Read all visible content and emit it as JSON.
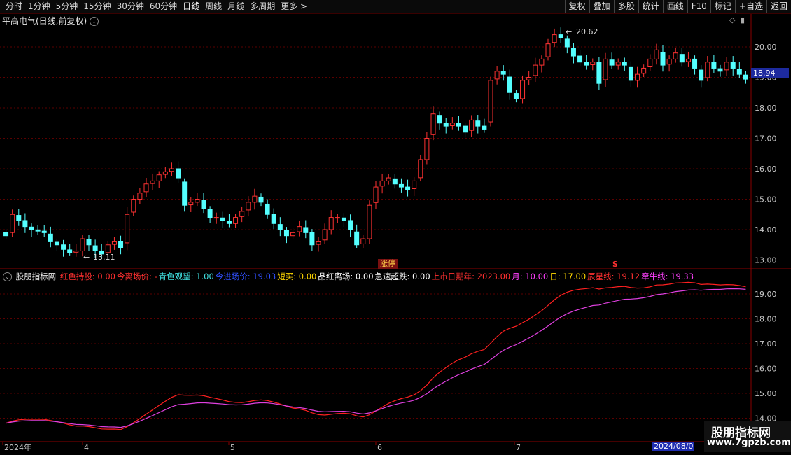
{
  "toolbar": {
    "periods": [
      "分时",
      "1分钟",
      "5分钟",
      "15分钟",
      "30分钟",
      "60分钟",
      "日线",
      "周线",
      "月线",
      "多周期",
      "更多 >"
    ],
    "active_period": "日线",
    "buttons": [
      "复权",
      "叠加",
      "多股",
      "统计",
      "画线",
      "F10",
      "标记",
      "+自选",
      "返回"
    ]
  },
  "title": "平高电气(日线,前复权)",
  "main_chart": {
    "y_ticks": [
      "20.00",
      "19.00",
      "18.00",
      "17.00",
      "16.00",
      "15.00",
      "14.00",
      "13.00"
    ],
    "current_price": "18.94",
    "high_label": "20.62",
    "low_label": "13.11",
    "badge": "涨停",
    "s_mark": "S"
  },
  "indicator": {
    "name": "股朋指标网",
    "fields": [
      {
        "label": "红色持股: 0.00",
        "color": "#ff3030"
      },
      {
        "label": "今离场价: -",
        "color": "#ff3030"
      },
      {
        "label": "青色观望: 1.00",
        "color": "#40e0e0"
      },
      {
        "label": "今进场价: 19.03",
        "color": "#3050ff"
      },
      {
        "label": "短买: 0.00",
        "color": "#ffd700"
      },
      {
        "label": "品红离场: 0.00",
        "color": "#ffffff"
      },
      {
        "label": "急速超跌: 0.00",
        "color": "#ffffff"
      },
      {
        "label": "上市日期年: 2023.00",
        "color": "#ff3030"
      },
      {
        "label": "月: 10.00",
        "color": "#ff40ff"
      },
      {
        "label": "日: 17.00",
        "color": "#ffd700"
      },
      {
        "label": "辰星线: 19.12",
        "color": "#ff3030"
      },
      {
        "label": "牵牛线: 19.33",
        "color": "#ff40ff"
      }
    ],
    "y_ticks": [
      "19.00",
      "18.00",
      "17.00",
      "16.00",
      "15.00",
      "14.00"
    ]
  },
  "x_axis": {
    "labels": [
      "2024年",
      "4",
      "5",
      "6",
      "7"
    ],
    "current_date": "2024/08/0"
  },
  "watermark": {
    "line1": "股朋指标网",
    "line2": "www.7gpzb.com"
  },
  "colors": {
    "up": "#ff3232",
    "down": "#54ffff",
    "grid": "#5a0000",
    "star": "#ff2020",
    "niu": "#e040e0"
  }
}
